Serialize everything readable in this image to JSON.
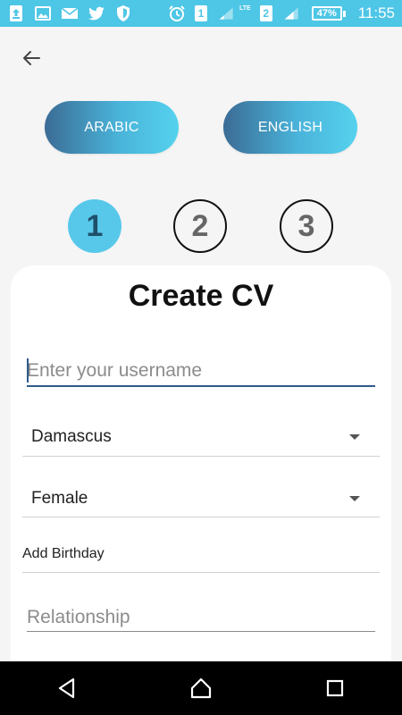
{
  "status_bar": {
    "left_icons": [
      "upload-notification-icon",
      "image-notification-icon",
      "mail-icon",
      "twitter-icon",
      "shield-icon"
    ],
    "sim1_label": "1",
    "sim1_network": "LTE",
    "sim2_label": "2",
    "battery_level": "47%",
    "time": "11:55"
  },
  "header": {
    "back_icon": "arrow-left-icon"
  },
  "language": {
    "arabic_label": "ARABIC",
    "english_label": "ENGLISH"
  },
  "steps": [
    {
      "label": "1",
      "active": true
    },
    {
      "label": "2",
      "active": false
    },
    {
      "label": "3",
      "active": false
    }
  ],
  "form": {
    "title": "Create CV",
    "username_placeholder": "Enter your username",
    "username_value": "",
    "city_selected": "Damascus",
    "gender_selected": "Female",
    "birthday_label": "Add Birthday",
    "relationship_placeholder": "Relationship",
    "relationship_value": ""
  },
  "colors": {
    "status_bar": "#4ec6e6",
    "accent": "#58c8ea",
    "gradient_start": "#3b6c95",
    "gradient_end": "#55d2ee",
    "input_underline": "#2f5a8a"
  },
  "nav": {
    "back_icon": "triangle-back-icon",
    "home_icon": "home-icon",
    "recents_icon": "square-recents-icon"
  }
}
